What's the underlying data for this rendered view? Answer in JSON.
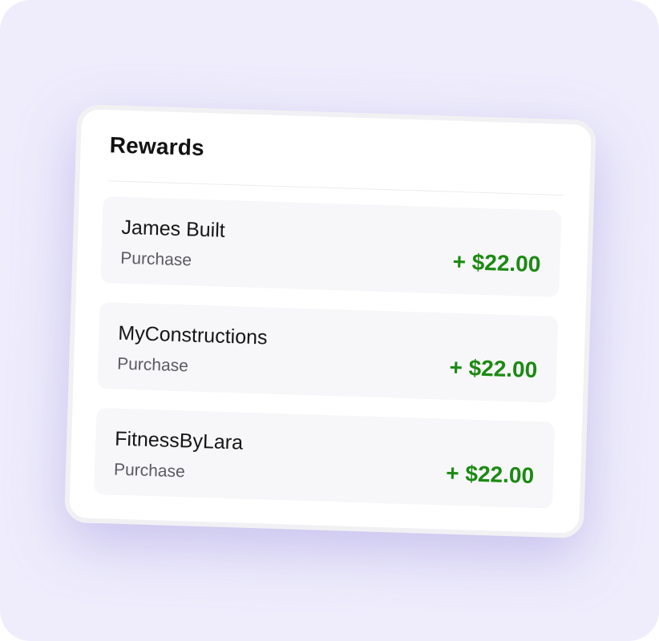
{
  "rewards": {
    "title": "Rewards",
    "items": [
      {
        "name": "James Built",
        "type": "Purchase",
        "amount": "+ $22.00"
      },
      {
        "name": "MyConstructions",
        "type": "Purchase",
        "amount": "+ $22.00"
      },
      {
        "name": "FitnessByLara",
        "type": "Purchase",
        "amount": "+ $22.00"
      }
    ]
  },
  "colors": {
    "background": "#efedfc",
    "card": "#ffffff",
    "row": "#f7f7f9",
    "amount": "#1b8a12"
  }
}
